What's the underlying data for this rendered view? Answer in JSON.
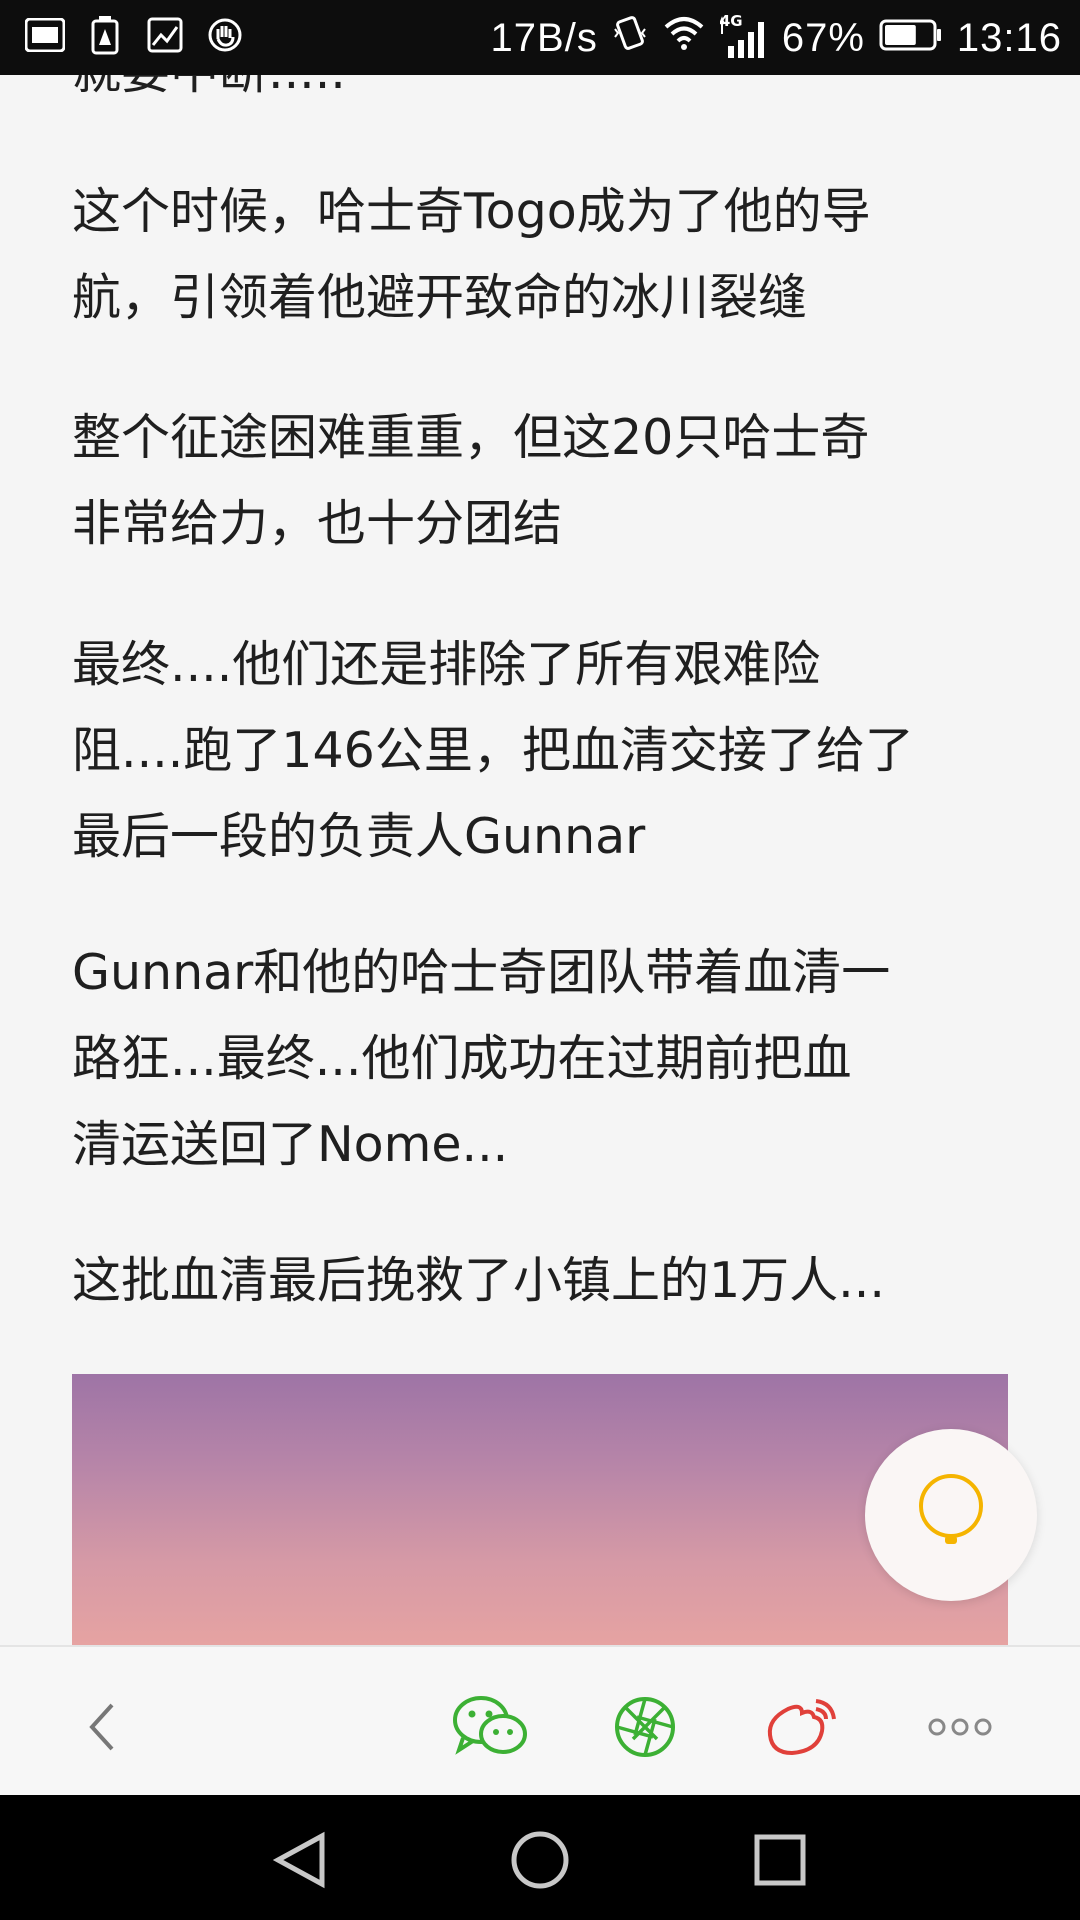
{
  "status_bar": {
    "left_icons": [
      "toutiao-icon",
      "battery-alert-icon",
      "image-icon",
      "hand-icon"
    ],
    "net_speed": "17B/s",
    "signal_label": "4G",
    "battery_percent": "67%",
    "time": "13:16",
    "battery_level": 0.67
  },
  "article": {
    "paragraphs": [
      "就要中断.....",
      "这个时候，哈士奇Togo成为了他的导\n航，引领着他避开致命的冰川裂缝",
      "整个征途困难重重，但这20只哈士奇\n非常给力，也十分团结",
      "最终....他们还是排除了所有艰难险\n阻....跑了146公里，把血清交接了给了\n最后一段的负责人Gunnar",
      "Gunnar和他的哈士奇团队带着血清一\n路狂...最终...他们成功在过期前把血\n清运送回了Nome...",
      "这批血清最后挽救了小镇上的1万人..."
    ]
  },
  "fab": {
    "icon": "lightbulb-icon",
    "color": "#f5b400"
  },
  "toolbar": {
    "back_icon": "chevron-left-icon",
    "share_wechat_icon": "wechat-icon",
    "share_moments_icon": "moments-icon",
    "share_weibo_icon": "weibo-icon",
    "more_icon": "more-icon",
    "wechat_color": "#3cb034",
    "weibo_color": "#e0403a"
  },
  "nav_bar": {
    "back_icon": "triangle-back-icon",
    "home_icon": "circle-home-icon",
    "recents_icon": "square-recents-icon"
  }
}
